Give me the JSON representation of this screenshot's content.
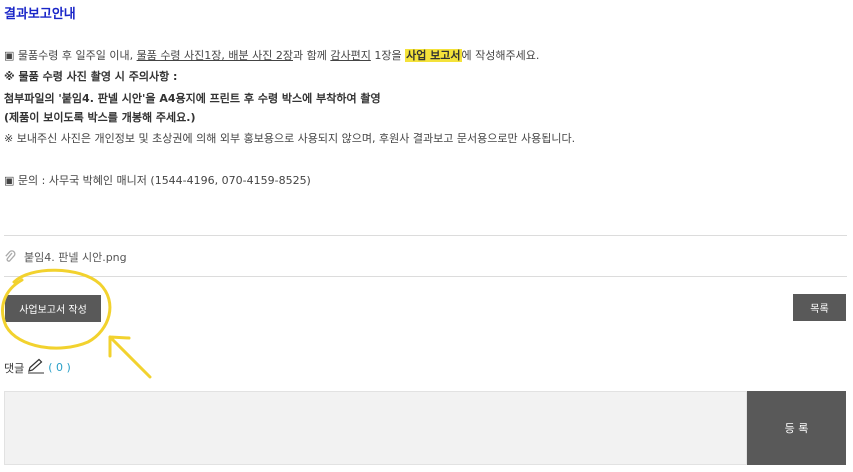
{
  "notice": {
    "title": "결과보고안내",
    "line1": {
      "p1": "▣ 물품수령 후 일주일 이내,  ",
      "p2": "물품 수령 사진1장, 배분 사진 2장",
      "p3": "과 함께 ",
      "p4": "감사편지",
      "p5": " 1장을 ",
      "p6": "사업 보고서",
      "p7": "에 작성해주세요."
    },
    "line2": "※ 물품 수령 사진 촬영 시 주의사항 :",
    "line3": "첨부파일의 '붙임4. 판넬 시안'을 A4용지에 프린트 후 수령 박스에 부착하여 촬영",
    "line4": "(제품이 보이도록 박스를 개봉해 주세요.)",
    "line5": "※ 보내주신 사진은 개인정보 및 초상권에 의해 외부 홍보용으로 사용되지 않으며, 후원사 결과보고 문서용으로만 사용됩니다.",
    "line6": "▣ 문의 : 사무국 박혜인 매니저 (1544-4196, 070-4159-8525)"
  },
  "attachment": {
    "filename": "붙임4. 판넬 시안.png",
    "icon": "paperclip-icon"
  },
  "buttons": {
    "report": "사업보고서 작성",
    "list": "목록",
    "submit": "등 록"
  },
  "comments": {
    "label": "댓글",
    "icon": "pencil-icon",
    "count": "( 0 )"
  },
  "colors": {
    "title": "#1a26c8",
    "highlight": "#f4e23a",
    "button": "#595959",
    "count": "#2aa0c8",
    "annotation": "#f2d22e"
  }
}
